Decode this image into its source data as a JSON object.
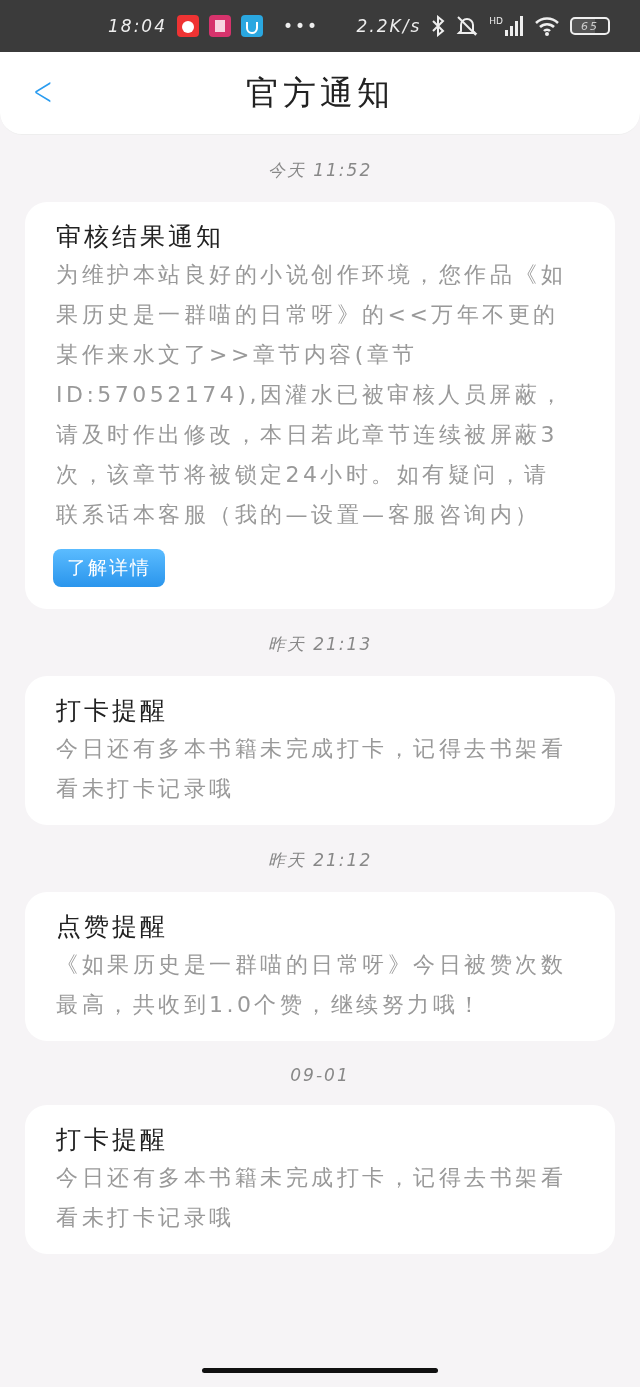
{
  "status_bar": {
    "time": "18:04",
    "more": "•••",
    "network_speed": "2.2K/s",
    "signal_label": "HD",
    "battery": "65"
  },
  "header": {
    "back": "<",
    "title": "官方通知"
  },
  "messages": [
    {
      "timestamp": "今天 11:52",
      "title": "审核结果通知",
      "body": "为维护本站良好的小说创作环境，您作品《如果历史是一群喵的日常呀》的<<万年不更的某作来水文了>>章节内容(章节ID:57052174),因灌水已被审核人员屏蔽，请及时作出修改，本日若此章节连续被屏蔽3次，该章节将被锁定24小时。如有疑问，请联系话本客服（我的—设置—客服咨询内）",
      "button": "了解详情"
    },
    {
      "timestamp": "昨天 21:13",
      "title": "打卡提醒",
      "body": "今日还有多本书籍未完成打卡，记得去书架看看未打卡记录哦"
    },
    {
      "timestamp": "昨天 21:12",
      "title": "点赞提醒",
      "body": "《如果历史是一群喵的日常呀》今日被赞次数最高，共收到1.0个赞，继续努力哦！"
    },
    {
      "timestamp": "09-01",
      "title": "打卡提醒",
      "body": "今日还有多本书籍未完成打卡，记得去书架看看未打卡记录哦"
    }
  ]
}
